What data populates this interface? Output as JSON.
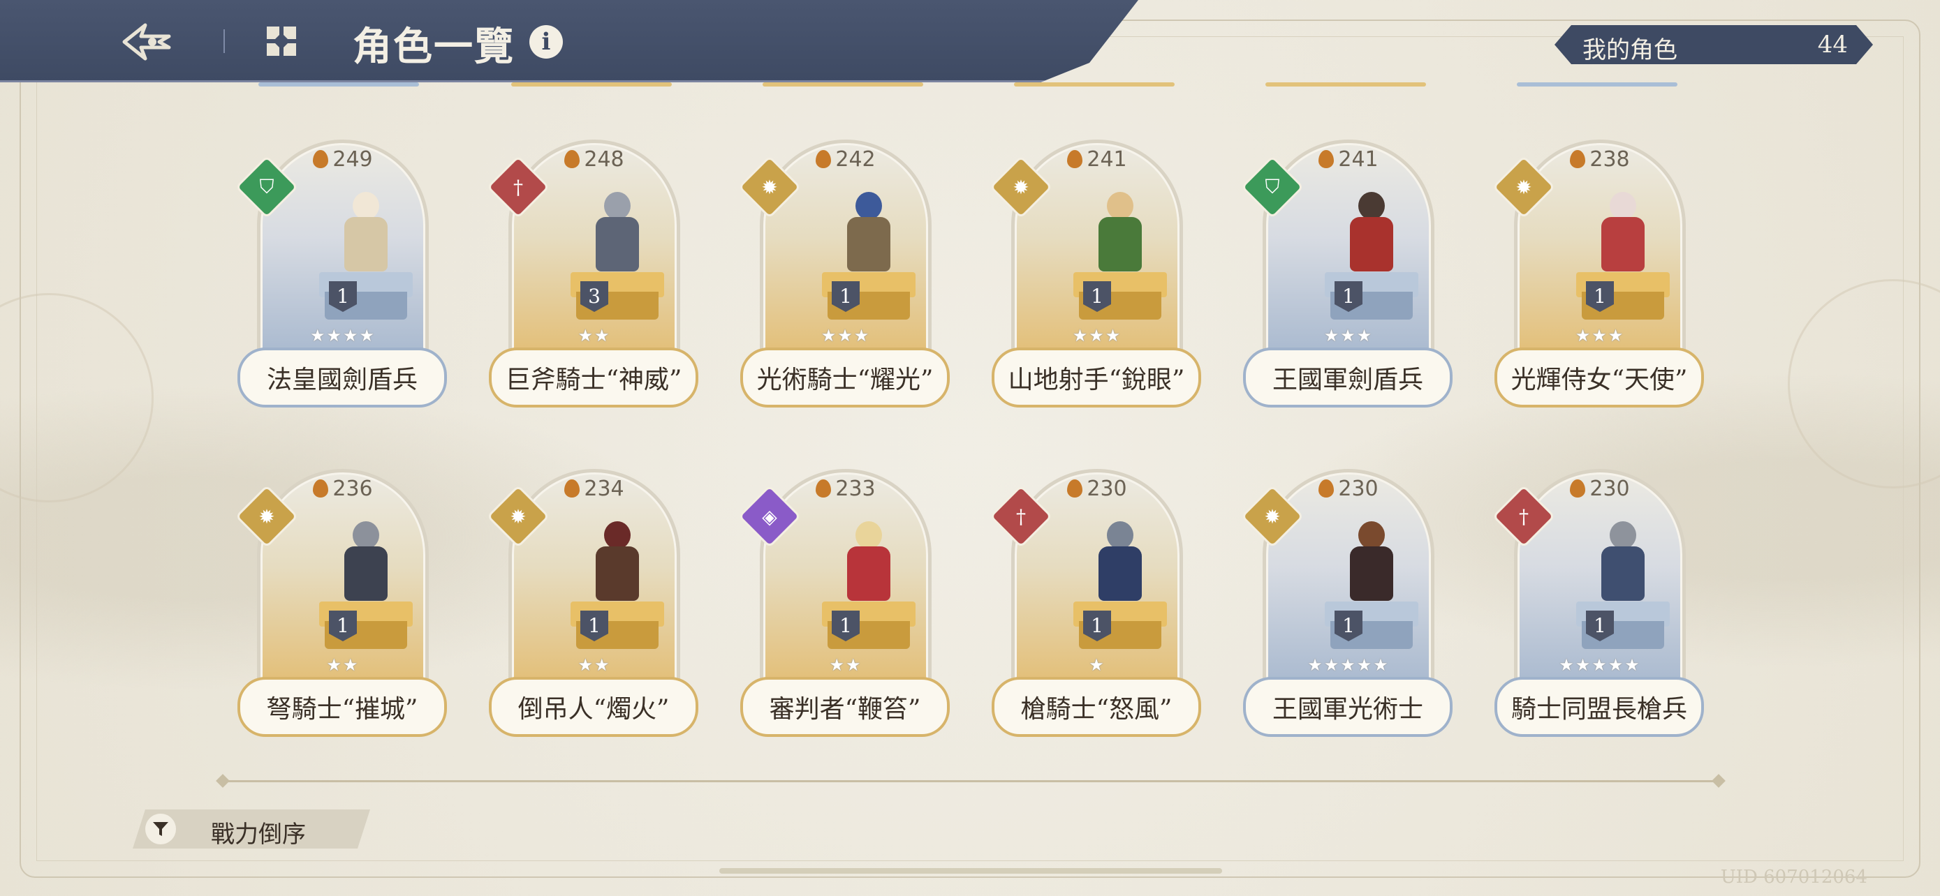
{
  "header": {
    "title": "角色一覽",
    "my_characters_label": "我的角色",
    "my_characters_count": "44"
  },
  "characters": [
    {
      "name": "法皇國劍盾兵",
      "power": "249",
      "level": "1",
      "stars": 4,
      "element": "green",
      "theme": "blue"
    },
    {
      "name": "巨斧騎士“神威”",
      "power": "248",
      "level": "3",
      "stars": 2,
      "element": "red",
      "theme": "gold"
    },
    {
      "name": "光術騎士“耀光”",
      "power": "242",
      "level": "1",
      "stars": 3,
      "element": "gold",
      "theme": "gold"
    },
    {
      "name": "山地射手“銳眼”",
      "power": "241",
      "level": "1",
      "stars": 3,
      "element": "gold",
      "theme": "gold"
    },
    {
      "name": "王國軍劍盾兵",
      "power": "241",
      "level": "1",
      "stars": 3,
      "element": "green",
      "theme": "blue"
    },
    {
      "name": "光輝侍女“天使”",
      "power": "238",
      "level": "1",
      "stars": 3,
      "element": "gold",
      "theme": "gold"
    },
    {
      "name": "弩騎士“摧城”",
      "power": "236",
      "level": "1",
      "stars": 2,
      "element": "gold",
      "theme": "gold"
    },
    {
      "name": "倒吊人“燭火”",
      "power": "234",
      "level": "1",
      "stars": 2,
      "element": "gold",
      "theme": "gold"
    },
    {
      "name": "審判者“鞭笞”",
      "power": "233",
      "level": "1",
      "stars": 2,
      "element": "purple",
      "theme": "gold"
    },
    {
      "name": "槍騎士“怒風”",
      "power": "230",
      "level": "1",
      "stars": 1,
      "element": "red",
      "theme": "gold"
    },
    {
      "name": "王國軍光術士",
      "power": "230",
      "level": "1",
      "stars": 5,
      "element": "gold",
      "theme": "blue"
    },
    {
      "name": "騎士同盟長槍兵",
      "power": "230",
      "level": "1",
      "stars": 5,
      "element": "red",
      "theme": "blue"
    }
  ],
  "sort": {
    "label": "戰力倒序"
  },
  "footer": {
    "uid": "UID 607012064"
  },
  "colors": {
    "header": "#3e4a63",
    "gold_card": "#e2b867",
    "blue_card": "#9fb2cb",
    "element_green": "#3c9a5a",
    "element_red": "#b24a4a",
    "element_gold": "#c9a24a",
    "element_purple": "#8a5bc8"
  },
  "icons": {
    "back": "back-arrow-icon",
    "grid": "grid-icon",
    "info": "info-icon",
    "sort": "filter-icon",
    "power": "flame-icon"
  }
}
